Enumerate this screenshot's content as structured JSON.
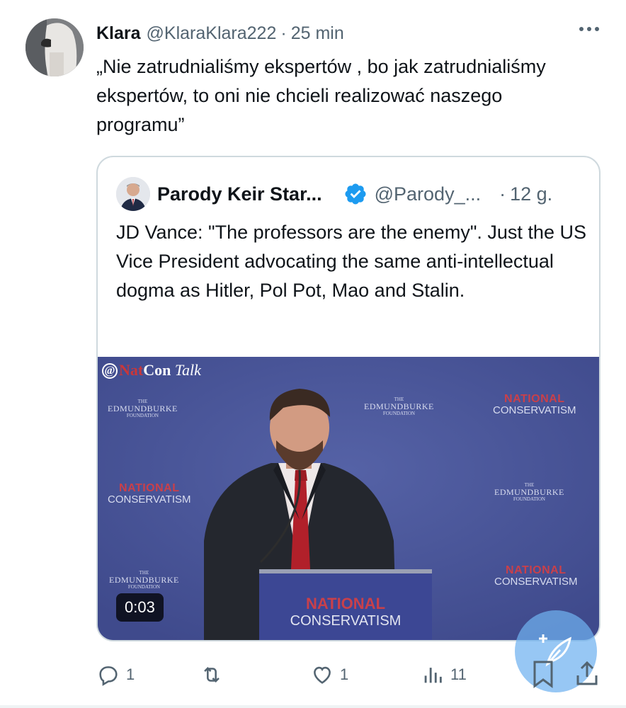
{
  "tweet": {
    "author_name": "Klara",
    "author_handle": "@KlaraKlara222",
    "separator": "·",
    "time": "25 min",
    "text": "„Nie zatrudnialiśmy ekspertów , bo jak zatrudnialiśmy ekspertów, to oni nie chcieli realizować naszego programu”"
  },
  "quoted": {
    "author_name": "Parody Keir Star...",
    "author_handle": "@Parody_...",
    "separator": "·",
    "time": "12 g.",
    "verified": true,
    "text": "JD Vance: \"The professors are the enemy\". Just the US Vice President advocating the same anti-intellectual dogma as Hitler, Pol Pot, Mao and Stalin.",
    "video": {
      "duration": "0:03",
      "watermark_at": "@",
      "watermark_nat": "Nat",
      "watermark_con": "Con",
      "watermark_talk": "Talk",
      "backdrop_nc_line1": "NATIONAL",
      "backdrop_nc_line2": "CONSERVATISM",
      "backdrop_ebf_small": "THE",
      "backdrop_ebf_big": "EDMUNDBURKE",
      "backdrop_ebf_sub": "FOUNDATION",
      "podium_line1": "NATIONAL",
      "podium_line2": "CONSERVATISM"
    }
  },
  "actions": {
    "replies": "1",
    "retweets": "",
    "likes": "1",
    "views": "11"
  },
  "colors": {
    "text_primary": "#0f1419",
    "text_secondary": "#536471",
    "border": "#cfd9de",
    "verified": "#1d9bf0",
    "fab": "#6fb2f0",
    "video_bg": "#4a5598",
    "nc_red": "#c9404a"
  },
  "icons": {
    "more": "more-horizontal-icon",
    "verified": "verified-badge-icon",
    "reply": "reply-icon",
    "retweet": "retweet-icon",
    "like": "heart-icon",
    "views": "views-icon",
    "bookmark": "bookmark-icon",
    "share": "share-icon",
    "compose": "compose-feather-icon"
  }
}
